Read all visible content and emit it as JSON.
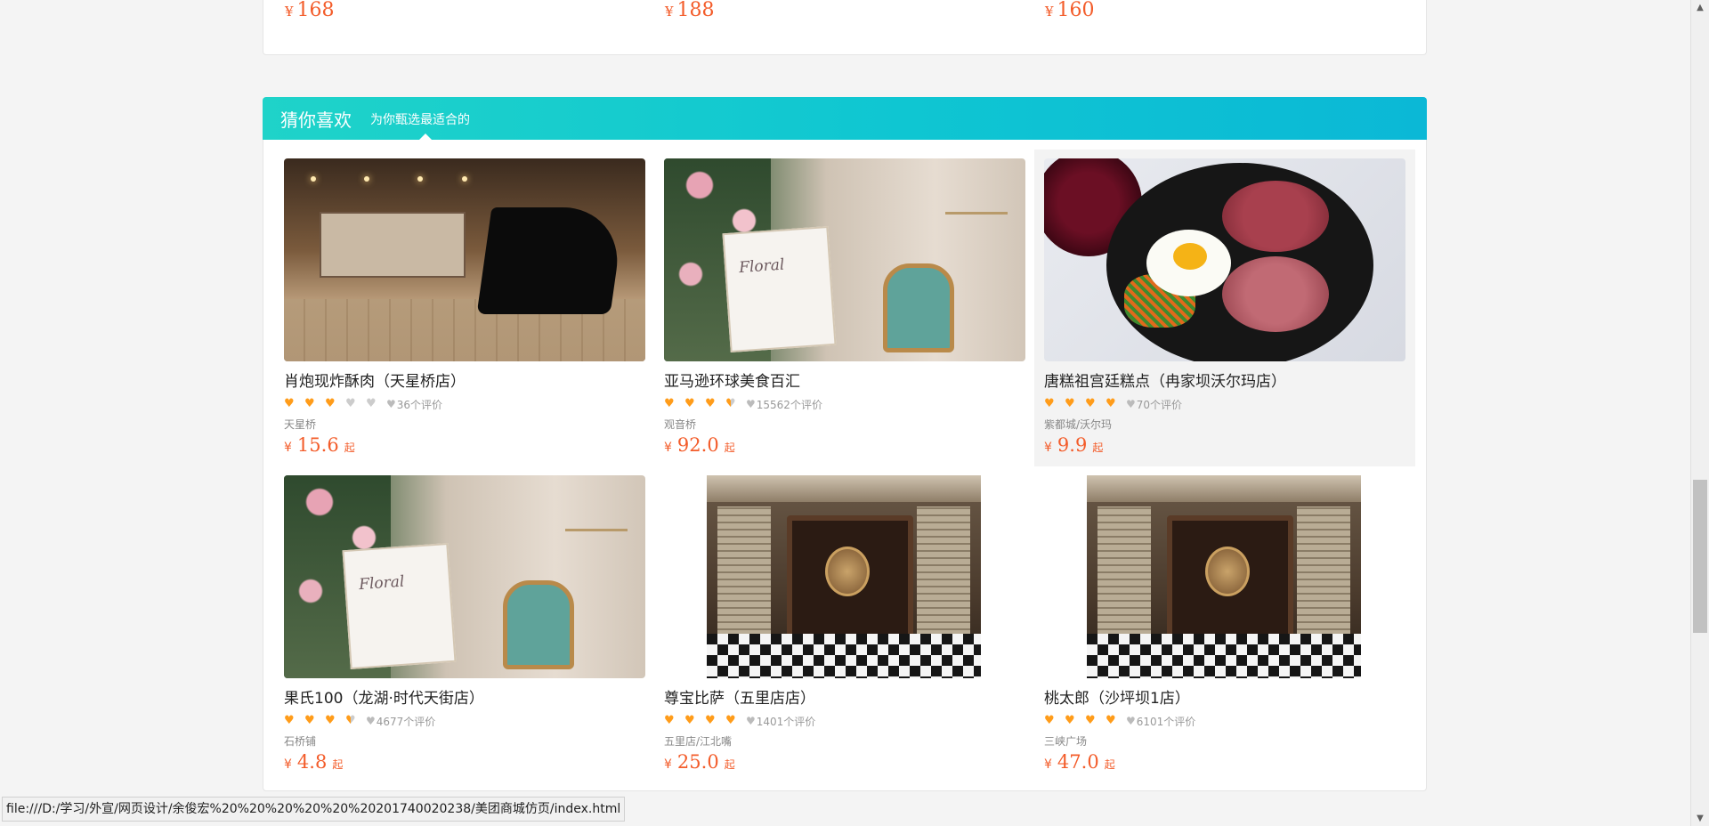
{
  "top_prices": [
    {
      "yen": "¥",
      "value": "168"
    },
    {
      "yen": "¥",
      "value": "188"
    },
    {
      "yen": "¥",
      "value": "160"
    }
  ],
  "guess": {
    "title": "猜你喜欢",
    "subtitle": "为你甄选最适合的"
  },
  "items": [
    {
      "name": "肖炮现炸酥肉（天星桥店）",
      "stars": [
        1,
        1,
        1,
        0,
        0
      ],
      "reviews": "36个评价",
      "area": "天星桥",
      "yen": "¥",
      "price": "15.6",
      "suffix": "起",
      "photo": "piano-lounge-photo"
    },
    {
      "name": "亚马逊环球美食百汇",
      "stars": [
        1,
        1,
        1,
        0.5,
        0
      ],
      "reviews": "15562个评价",
      "area": "观音桥",
      "yen": "¥",
      "price": "92.0",
      "suffix": "起",
      "photo": "floral-sign-photo"
    },
    {
      "name": "唐糕祖宫廷糕点（冉家坝沃尔玛店）",
      "stars": [
        1,
        1,
        1,
        1,
        0
      ],
      "reviews": "70个评价",
      "area": "紫都城/沃尔玛",
      "yen": "¥",
      "price": "9.9",
      "suffix": "起",
      "photo": "bibimbap-photo"
    },
    {
      "name": "果氏100（龙湖·时代天街店）",
      "stars": [
        1,
        1,
        1,
        0.5,
        0
      ],
      "reviews": "4677个评价",
      "area": "石桥铺",
      "yen": "¥",
      "price": "4.8",
      "suffix": "起",
      "photo": "floral-sign-photo"
    },
    {
      "name": "尊宝比萨（五里店店）",
      "stars": [
        1,
        1,
        1,
        1,
        0
      ],
      "reviews": "1401个评价",
      "area": "五里店/江北嘴",
      "yen": "¥",
      "price": "25.0",
      "suffix": "起",
      "photo": "hallway-photo"
    },
    {
      "name": "桃太郎（沙坪坝1店）",
      "stars": [
        1,
        1,
        1,
        1,
        0
      ],
      "reviews": "6101个评价",
      "area": "三峡广场",
      "yen": "¥",
      "price": "47.0",
      "suffix": "起",
      "photo": "hallway-photo"
    }
  ],
  "icons": {
    "star": "heart-icon",
    "review": "heart-icon"
  },
  "colors": {
    "accent": "#f35c2a",
    "header_start": "#1fd3c9",
    "header_end": "#0bb8d6",
    "star_on": "#ff9c1a",
    "star_off": "#cccccc"
  },
  "status_bar": {
    "url": "file:///D:/学习/外宣/网页设计/余俊宏%20%20%20%20%20%20201740020238/美团商城仿页/index.html"
  },
  "scrollbar": {
    "up": "▲",
    "down": "▼"
  }
}
